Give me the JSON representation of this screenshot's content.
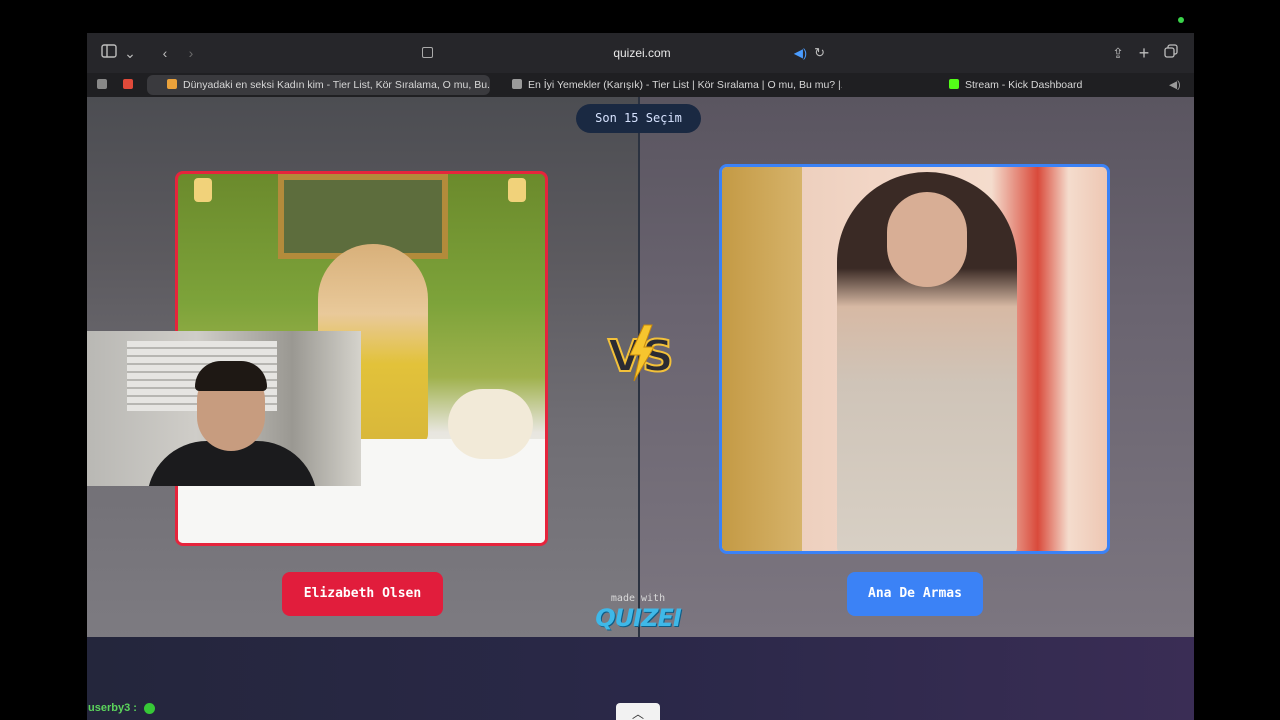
{
  "browser": {
    "url": "quizei.com",
    "tabs": [
      {
        "title": "Dünyadaki en seksi Kadın kim - Tier List, Kör Sıralama, O mu, Bu...",
        "active": true
      },
      {
        "title": "En İyi Yemekler (Karışık) - Tier List | Kör Sıralama | O mu, Bu mu? |...",
        "active": false
      },
      {
        "title": "Stream - Kick Dashboard",
        "active": false
      }
    ],
    "icons": [
      "sidebar-icon",
      "chevron-down-icon",
      "back-icon",
      "forward-icon",
      "audio-icon",
      "reload-icon",
      "share-icon",
      "new-tab-icon",
      "tab-overview-icon",
      "mute-icon"
    ]
  },
  "page": {
    "round_badge": "Son 15 Seçim",
    "left_choice": {
      "name": "Elizabeth Olsen",
      "color": "#e11d3c"
    },
    "right_choice": {
      "name": "Ana De Armas",
      "color": "#3b82f6"
    },
    "vs_text": "VS",
    "made_with": "made with",
    "brand": "QUIZEI"
  },
  "chat": {
    "user": "userby3",
    "separator": ":"
  }
}
